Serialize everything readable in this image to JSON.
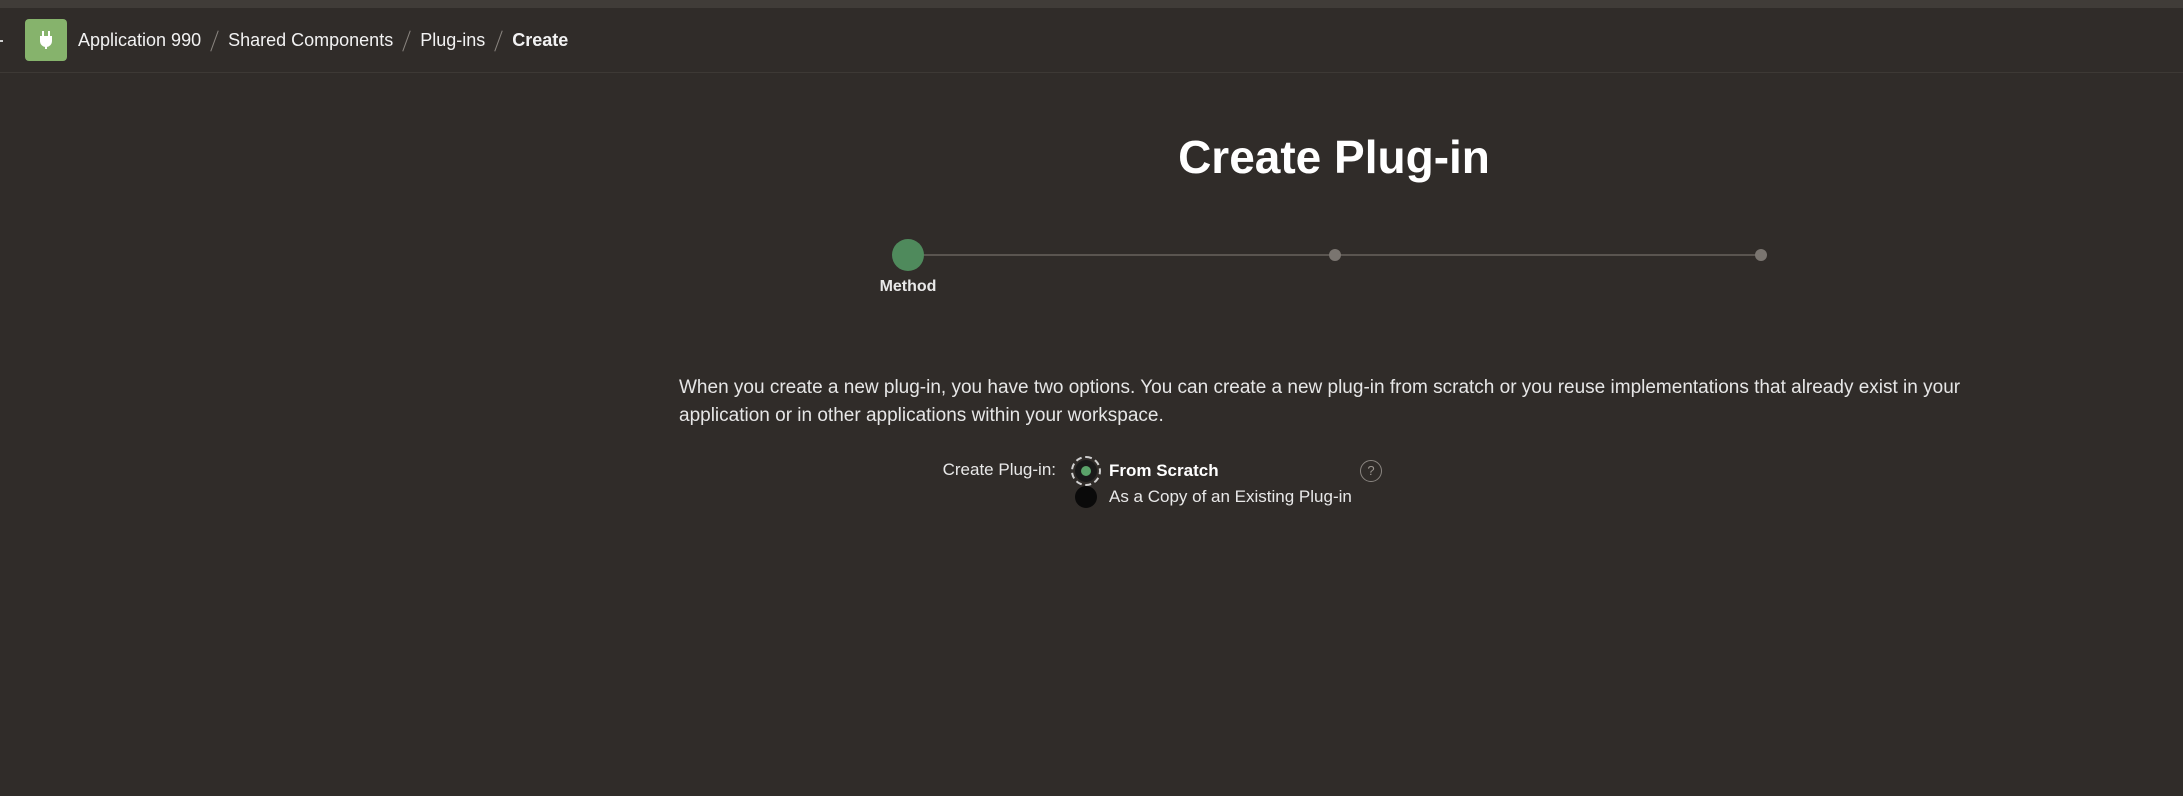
{
  "header": {
    "logo_icon": "plug-icon",
    "logo_color": "#86b36c",
    "breadcrumb": [
      {
        "label": "Application 990"
      },
      {
        "label": "Shared Components"
      },
      {
        "label": "Plug-ins"
      },
      {
        "label": "Create"
      }
    ]
  },
  "page": {
    "title": "Create Plug-in"
  },
  "wizard": {
    "steps": [
      {
        "label": "Method",
        "state": "current"
      },
      {
        "label": "",
        "state": "upcoming"
      },
      {
        "label": "",
        "state": "upcoming"
      }
    ],
    "current_step_color": "#4f8a5c"
  },
  "form": {
    "intro": "When you create a new plug-in, you have two options. You can create a new plug-in from scratch or you reuse implementations that already exist in your application or in other applications within your workspace.",
    "create_label": "Create Plug-in:",
    "options": [
      {
        "label": "From Scratch",
        "selected": true
      },
      {
        "label": "As a Copy of an Existing Plug-in",
        "selected": false
      }
    ],
    "help_icon": "help-icon",
    "help_glyph": "?"
  }
}
